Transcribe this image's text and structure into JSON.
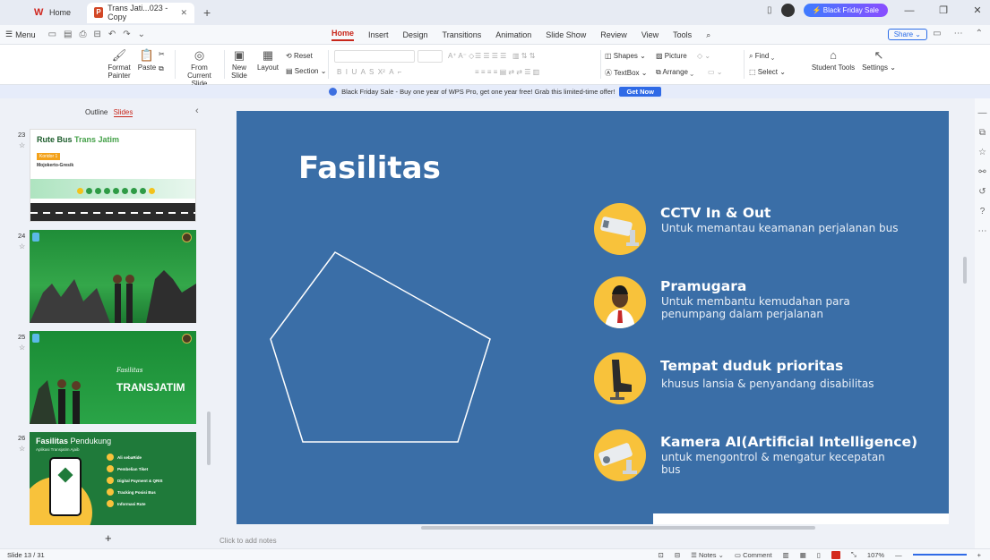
{
  "titlebar": {
    "home_tab": "Home",
    "doc_tab": "Trans Jati...023 - Copy",
    "black_friday_btn": "Black Friday Sale"
  },
  "menu": {
    "menu_label": "Menu",
    "tabs": [
      "Home",
      "Insert",
      "Design",
      "Transitions",
      "Animation",
      "Slide Show",
      "Review",
      "View",
      "Tools"
    ],
    "active_tab": "Home",
    "share_label": "Share"
  },
  "ribbon": {
    "format_painter": "Format Painter",
    "paste": "Paste",
    "from_current": "From Current Slide",
    "new_slide": "New Slide",
    "layout": "Layout",
    "reset": "Reset",
    "section": "Section",
    "shapes": "Shapes",
    "picture": "Picture",
    "textbox": "TextBox",
    "arrange": "Arrange",
    "find": "Find",
    "select": "Select",
    "student_tools": "Student Tools",
    "settings": "Settings"
  },
  "notification": {
    "text": "Black Friday Sale - Buy one year of WPS Pro, get one year free! Grab this limited-time offer!",
    "button": "Get Now"
  },
  "panel": {
    "outline_tab": "Outline",
    "slides_tab": "Slides",
    "thumbnails": [
      {
        "number": "23",
        "title": "Rute Bus",
        "title_accent": "Trans Jatim",
        "badge": "Koridor 1",
        "subtitle": "Mojokerto-Gresik"
      },
      {
        "number": "24"
      },
      {
        "number": "25",
        "script": "Fasilitas",
        "headline": "TRANSJATIM"
      },
      {
        "number": "26",
        "title": "Fasilitas",
        "title_accent": "Pendukung",
        "subtitle": "Aplikasi Transjatim Ajaib",
        "items": [
          "Ali sebaRide",
          "Pembelian Tiket",
          "Digital Payment & QRIS",
          "Tracking Posisi Bus",
          "Informasi Rute"
        ]
      }
    ]
  },
  "slide": {
    "title": "Fasilitas",
    "facilities": [
      {
        "title": "CCTV In & Out",
        "desc": "Untuk memantau keamanan perjalanan bus"
      },
      {
        "title": "Pramugara",
        "desc": "Untuk membantu kemudahan para penumpang dalam perjalanan"
      },
      {
        "title": "Tempat duduk prioritas",
        "desc": "khusus lansia & penyandang disabilitas"
      },
      {
        "title": "Kamera AI(Artificial Intelligence)",
        "desc": "untuk mengontrol & mengatur kecepatan bus"
      }
    ]
  },
  "notes_placeholder": "Click to add notes",
  "status": {
    "slide_count": "Slide 13 / 31",
    "notes": "Notes",
    "comment": "Comment",
    "zoom": "107%"
  }
}
